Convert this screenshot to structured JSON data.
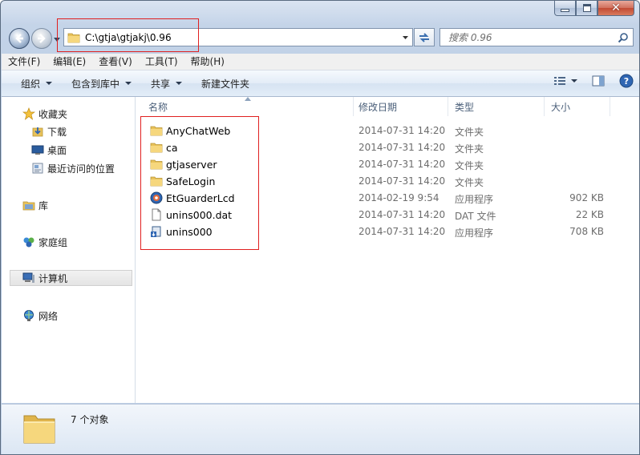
{
  "window": {
    "address": "C:\\gtja\\gtjakj\\0.96",
    "search_placeholder": "搜索 0.96",
    "caption": {
      "minimize": "–",
      "maximize": "□",
      "close": "✕"
    }
  },
  "menu": [
    "文件(F)",
    "编辑(E)",
    "查看(V)",
    "工具(T)",
    "帮助(H)"
  ],
  "commands": {
    "organize": "组织",
    "include_in_library": "包含到库中",
    "share": "共享",
    "new_folder": "新建文件夹"
  },
  "navpane": {
    "favorites": "收藏夹",
    "downloads": "下载",
    "desktop": "桌面",
    "recent": "最近访问的位置",
    "libraries": "库",
    "homegroup": "家庭组",
    "computer": "计算机",
    "network": "网络"
  },
  "columns": {
    "name": "名称",
    "date": "修改日期",
    "type": "类型",
    "size": "大小"
  },
  "files": [
    {
      "name": "AnyChatWeb",
      "date": "2014-07-31 14:20",
      "type": "文件夹",
      "size": "",
      "icon": "folder-icon"
    },
    {
      "name": "ca",
      "date": "2014-07-31 14:20",
      "type": "文件夹",
      "size": "",
      "icon": "folder-icon"
    },
    {
      "name": "gtjaserver",
      "date": "2014-07-31 14:20",
      "type": "文件夹",
      "size": "",
      "icon": "folder-icon"
    },
    {
      "name": "SafeLogin",
      "date": "2014-07-31 14:20",
      "type": "文件夹",
      "size": "",
      "icon": "folder-icon"
    },
    {
      "name": "EtGuarderLcd",
      "date": "2014-02-19 9:54",
      "type": "应用程序",
      "size": "902 KB",
      "icon": "app-icon"
    },
    {
      "name": "unins000.dat",
      "date": "2014-07-31 14:20",
      "type": "DAT 文件",
      "size": "22 KB",
      "icon": "file-icon"
    },
    {
      "name": "unins000",
      "date": "2014-07-31 14:20",
      "type": "应用程序",
      "size": "708 KB",
      "icon": "installer-icon"
    }
  ],
  "details": {
    "count": "7 个对象"
  }
}
